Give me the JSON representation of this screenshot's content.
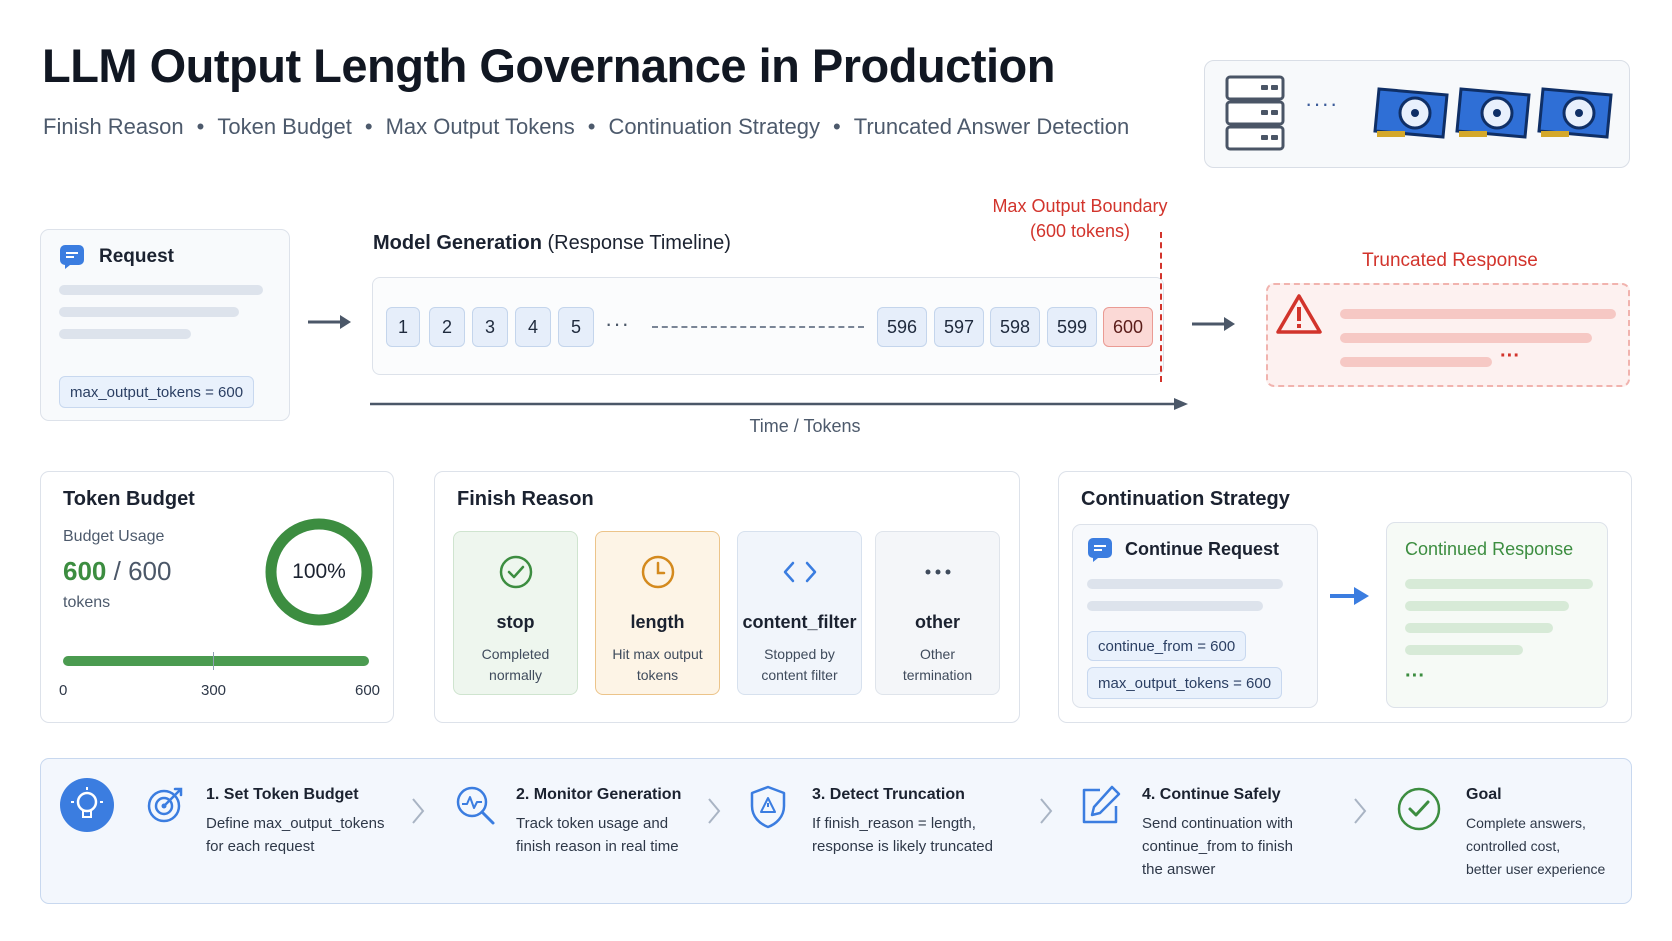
{
  "header": {
    "title": "LLM Output Length Governance in Production",
    "topics": [
      "Finish Reason",
      "Token Budget",
      "Max Output Tokens",
      "Continuation Strategy",
      "Truncated Answer Detection"
    ],
    "topic_separator": "•",
    "hardware_ellipsis": "····"
  },
  "request": {
    "title": "Request",
    "param": "max_output_tokens = 600"
  },
  "generation": {
    "title": "Model Generation",
    "title_suffix": "(Response Timeline)",
    "boundary_label_1": "Max Output Boundary",
    "boundary_label_2": "(600 tokens)",
    "tokens_start": [
      "1",
      "2",
      "3",
      "4",
      "5"
    ],
    "ellipsis": "···",
    "tokens_end": [
      "596",
      "597",
      "598",
      "599",
      "600"
    ],
    "axis_label": "Time / Tokens"
  },
  "truncated": {
    "title": "Truncated Response",
    "ellipsis": "···"
  },
  "token_budget": {
    "title": "Token Budget",
    "usage_label": "Budget Usage",
    "used": "600",
    "slash_total": "/ 600",
    "unit": "tokens",
    "percent_text": "100%",
    "usage_fraction": 1.0,
    "scale": [
      "0",
      "300",
      "600"
    ]
  },
  "finish_reason": {
    "title": "Finish Reason",
    "items": [
      {
        "name": "stop",
        "desc": [
          "Completed",
          "normally"
        ],
        "icon": "check-circle-icon"
      },
      {
        "name": "length",
        "desc": [
          "Hit max output",
          "tokens"
        ],
        "icon": "clock-icon"
      },
      {
        "name": "content_filter",
        "desc": [
          "Stopped by",
          "content filter"
        ],
        "icon": "code-icon"
      },
      {
        "name": "other",
        "desc": [
          "Other",
          "termination"
        ],
        "icon": "ellipsis-icon"
      }
    ]
  },
  "continuation": {
    "title": "Continuation Strategy",
    "request_title": "Continue Request",
    "param1": "continue_from = 600",
    "param2": "max_output_tokens = 600",
    "response_title": "Continued Response",
    "ellipsis": "···"
  },
  "steps": [
    {
      "title": "1. Set Token Budget",
      "desc": [
        "Define max_output_tokens",
        "for each request"
      ],
      "icon": "target-icon"
    },
    {
      "title": "2. Monitor Generation",
      "desc": [
        "Track token usage and",
        "finish reason in real time"
      ],
      "icon": "monitor-search-icon"
    },
    {
      "title": "3. Detect Truncation",
      "desc": [
        "If finish_reason = length,",
        "response is likely truncated"
      ],
      "icon": "shield-alert-icon"
    },
    {
      "title": "4. Continue Safely",
      "desc": [
        "Send continuation with",
        "continue_from to finish",
        "the answer"
      ],
      "icon": "edit-icon"
    },
    {
      "title": "Goal",
      "desc": [
        "Complete answers,",
        "controlled cost,",
        "better user experience"
      ],
      "icon": "check-circle-icon"
    }
  ],
  "colors": {
    "accent_blue": "#3b7de0",
    "danger_red": "#d2342c",
    "success_green": "#3c8d40",
    "warning_orange": "#d48a1e"
  }
}
